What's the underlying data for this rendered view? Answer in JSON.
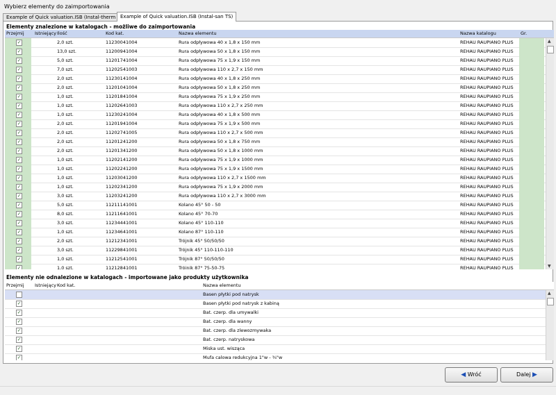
{
  "window": {
    "title": "Wybierz elementy do zaimportowania"
  },
  "tabs": [
    {
      "label": "Example of Quick valuation.ISB (Instal-therm HCR)",
      "active": false
    },
    {
      "label": "Example of Quick valuation.ISB (Instal-san TS)",
      "active": true
    }
  ],
  "found": {
    "title": "Elementy znalezione w katalogach - możliwe do zaimportowania",
    "columns": {
      "przejmij": "Przejmij",
      "istniejacy": "Istniejący",
      "ilosc": "Ilość",
      "kod": "Kod kat.",
      "nazwa": "Nazwa elementu",
      "katalog": "Nazwa katalogu",
      "gr": "Gr."
    },
    "rows": [
      {
        "qty": "2,0 szt.",
        "code": "11230041004",
        "name": "Rura odpływowa 40 x 1,8 x 150 mm",
        "catalog": "REHAU RAUPIANO PLUS"
      },
      {
        "qty": "13,0 szt.",
        "code": "11200941004",
        "name": "Rura odpływowa 50 x 1,8 x 150 mm",
        "catalog": "REHAU RAUPIANO PLUS"
      },
      {
        "qty": "5,0 szt.",
        "code": "11201741004",
        "name": "Rura odpływowa 75 x 1,9 x 150 mm",
        "catalog": "REHAU RAUPIANO PLUS"
      },
      {
        "qty": "7,0 szt.",
        "code": "11202541003",
        "name": "Rura odpływowa 110 x 2,7 x 150 mm",
        "catalog": "REHAU RAUPIANO PLUS"
      },
      {
        "qty": "2,0 szt.",
        "code": "11230141004",
        "name": "Rura odpływowa 40 x 1,8 x 250 mm",
        "catalog": "REHAU RAUPIANO PLUS"
      },
      {
        "qty": "2,0 szt.",
        "code": "11201041004",
        "name": "Rura odpływowa 50 x 1,8 x 250 mm",
        "catalog": "REHAU RAUPIANO PLUS"
      },
      {
        "qty": "1,0 szt.",
        "code": "11201841004",
        "name": "Rura odpływowa 75 x 1,9 x 250 mm",
        "catalog": "REHAU RAUPIANO PLUS"
      },
      {
        "qty": "1,0 szt.",
        "code": "11202641003",
        "name": "Rura odpływowa 110 x 2,7 x 250 mm",
        "catalog": "REHAU RAUPIANO PLUS"
      },
      {
        "qty": "1,0 szt.",
        "code": "11230241004",
        "name": "Rura odpływowa 40 x 1,8 x 500 mm",
        "catalog": "REHAU RAUPIANO PLUS"
      },
      {
        "qty": "2,0 szt.",
        "code": "11201941004",
        "name": "Rura odpływowa 75 x 1,9 x 500 mm",
        "catalog": "REHAU RAUPIANO PLUS"
      },
      {
        "qty": "2,0 szt.",
        "code": "11202741005",
        "name": "Rura odpływowa 110 x 2,7 x 500 mm",
        "catalog": "REHAU RAUPIANO PLUS"
      },
      {
        "qty": "2,0 szt.",
        "code": "11201241200",
        "name": "Rura odpływowa 50 x 1,8 x 750 mm",
        "catalog": "REHAU RAUPIANO PLUS"
      },
      {
        "qty": "2,0 szt.",
        "code": "11201341200",
        "name": "Rura odpływowa 50 x 1,8 x 1000 mm",
        "catalog": "REHAU RAUPIANO PLUS"
      },
      {
        "qty": "1,0 szt.",
        "code": "11202141200",
        "name": "Rura odpływowa 75 x 1,9 x 1000 mm",
        "catalog": "REHAU RAUPIANO PLUS"
      },
      {
        "qty": "1,0 szt.",
        "code": "11202241200",
        "name": "Rura odpływowa 75 x 1,9 x 1500 mm",
        "catalog": "REHAU RAUPIANO PLUS"
      },
      {
        "qty": "1,0 szt.",
        "code": "11203041200",
        "name": "Rura odpływowa 110 x 2,7 x 1500 mm",
        "catalog": "REHAU RAUPIANO PLUS"
      },
      {
        "qty": "1,0 szt.",
        "code": "11202341200",
        "name": "Rura odpływowa 75 x 1,9 x 2000 mm",
        "catalog": "REHAU RAUPIANO PLUS"
      },
      {
        "qty": "3,0 szt.",
        "code": "11203241200",
        "name": "Rura odpływowa 110 x 2,7 x 3000 mm",
        "catalog": "REHAU RAUPIANO PLUS"
      },
      {
        "qty": "5,0 szt.",
        "code": "11211141001",
        "name": "Kolano 45° 50 - 50",
        "catalog": "REHAU RAUPIANO PLUS"
      },
      {
        "qty": "8,0 szt.",
        "code": "11211641001",
        "name": "Kolano 45° 70-70",
        "catalog": "REHAU RAUPIANO PLUS"
      },
      {
        "qty": "3,0 szt.",
        "code": "11234441001",
        "name": "Kolano 45° 110-110",
        "catalog": "REHAU RAUPIANO PLUS"
      },
      {
        "qty": "1,0 szt.",
        "code": "11234641001",
        "name": "Kolano 87° 110-110",
        "catalog": "REHAU RAUPIANO PLUS"
      },
      {
        "qty": "2,0 szt.",
        "code": "11212341001",
        "name": "Trójnik 45° 50/50/50",
        "catalog": "REHAU RAUPIANO PLUS"
      },
      {
        "qty": "3,0 szt.",
        "code": "11229841001",
        "name": "Trójnik 45° 110-110-110",
        "catalog": "REHAU RAUPIANO PLUS"
      },
      {
        "qty": "1,0 szt.",
        "code": "11212541001",
        "name": "Trójnik 87° 50/50/50",
        "catalog": "REHAU RAUPIANO PLUS"
      },
      {
        "qty": "1,0 szt.",
        "code": "11212841001",
        "name": "Trójnik 87° 75-50-75",
        "catalog": "REHAU RAUPIANO PLUS"
      }
    ]
  },
  "notfound": {
    "title": "Elementy nie odnalezione w katalogach - importowane jako produkty użytkownika",
    "columns": {
      "przejmij": "Przejmij",
      "istniejacy": "Istniejący",
      "kod": "Kod kat.",
      "nazwa": "Nazwa elementu"
    },
    "rows": [
      {
        "name": "Basen płytki pod natrysk",
        "checked": false
      },
      {
        "name": "Basen płytki pod natrysk z kabiną",
        "checked": true
      },
      {
        "name": "Bat. czerp. dla umywalki",
        "checked": true
      },
      {
        "name": "Bat. czerp. dla wanny",
        "checked": true
      },
      {
        "name": "Bat. czerp. dla zlewozmywaka",
        "checked": true
      },
      {
        "name": "Bat. czerp. natryskowa",
        "checked": true
      },
      {
        "name": "Miska ust. wisząca",
        "checked": true
      },
      {
        "name": "Mufa calowa redukcyjna 1\"w - ¾\"w",
        "checked": true
      }
    ]
  },
  "buttons": {
    "back": "Wróć",
    "next": "Dalej"
  },
  "check_mark": "✓",
  "colors": {
    "green_cell": "#cde5c9",
    "header_blue": "#c9d6f0",
    "button_icon": "#1c4fb5"
  }
}
